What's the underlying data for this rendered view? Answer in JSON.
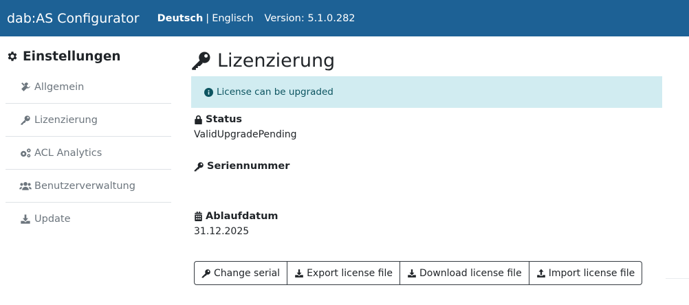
{
  "header": {
    "brand": "dab:AS Configurator",
    "lang_active": "Deutsch",
    "lang_separator": "|",
    "lang_other": "Englisch",
    "version": "Version: 5.1.0.282"
  },
  "sidebar": {
    "title": "Einstellungen",
    "items": [
      {
        "label": "Allgemein",
        "icon": "tools-icon"
      },
      {
        "label": "Lizenzierung",
        "icon": "key-icon"
      },
      {
        "label": "ACL Analytics",
        "icon": "cogs-icon"
      },
      {
        "label": "Benutzerverwaltung",
        "icon": "users-icon"
      },
      {
        "label": "Update",
        "icon": "download-icon"
      }
    ]
  },
  "main": {
    "title": "Lizenzierung",
    "alert": "License can be upgraded",
    "status_label": "Status",
    "status_value": "ValidUpgradePending",
    "serial_label": "Seriennummer",
    "serial_value": "",
    "expiry_label": "Ablaufdatum",
    "expiry_value": "31.12.2025",
    "buttons": {
      "change_serial": "Change serial",
      "export": "Export license file",
      "download": "Download license file",
      "import": "Import license file"
    }
  },
  "colors": {
    "navbar": "#1d6195",
    "alert_bg": "#d1ecf1",
    "alert_text": "#0c5460",
    "muted": "#6c757d"
  }
}
